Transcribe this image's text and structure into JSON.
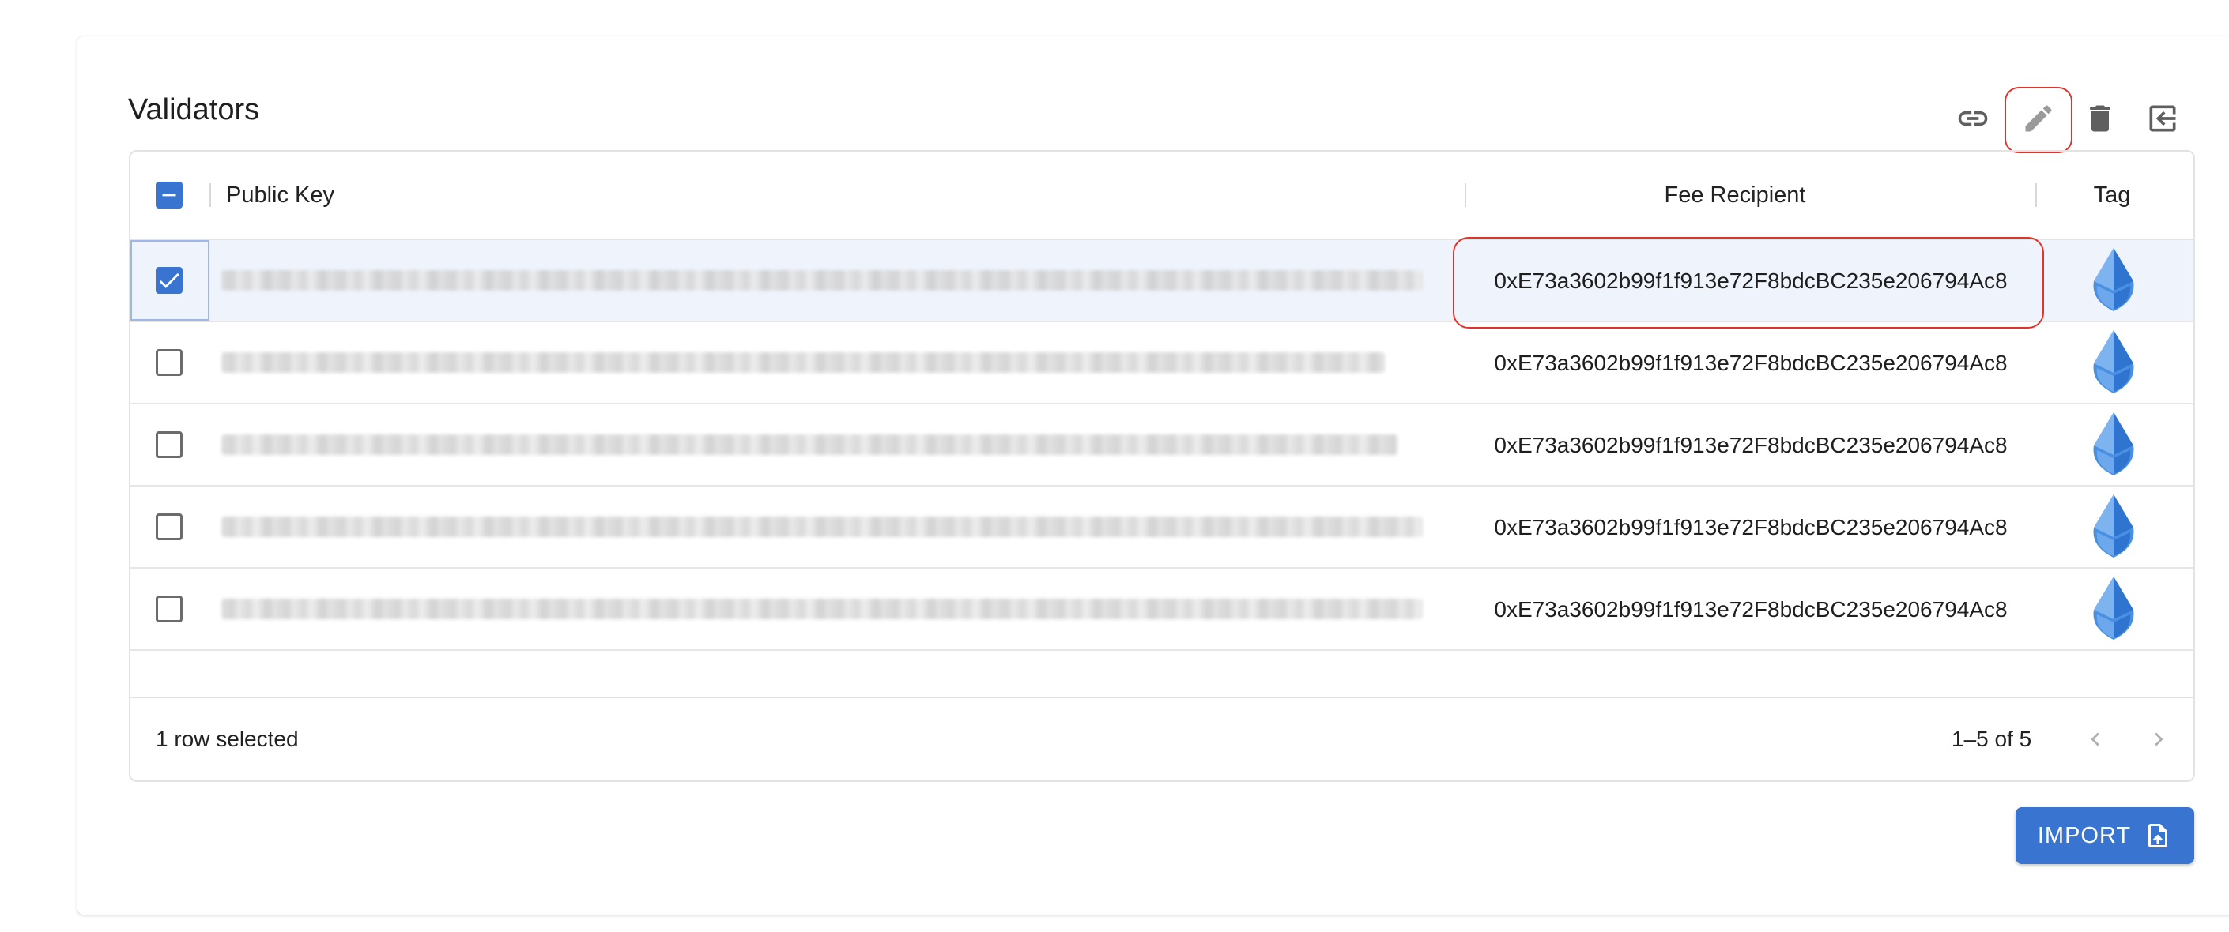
{
  "card": {
    "title": "Validators"
  },
  "toolbar": {
    "icons": [
      "link-icon",
      "edit-icon",
      "delete-icon",
      "exit-icon"
    ]
  },
  "table": {
    "columns": {
      "public_key": "Public Key",
      "fee_recipient": "Fee Recipient",
      "tag": "Tag"
    },
    "rows": [
      {
        "selected": true,
        "fee_recipient": "0xE73a3602b99f1f913e72F8bdcBC235e206794Ac8",
        "tag_icon": "ethereum-drop-icon"
      },
      {
        "selected": false,
        "fee_recipient": "0xE73a3602b99f1f913e72F8bdcBC235e206794Ac8",
        "tag_icon": "ethereum-drop-icon"
      },
      {
        "selected": false,
        "fee_recipient": "0xE73a3602b99f1f913e72F8bdcBC235e206794Ac8",
        "tag_icon": "ethereum-drop-icon"
      },
      {
        "selected": false,
        "fee_recipient": "0xE73a3602b99f1f913e72F8bdcBC235e206794Ac8",
        "tag_icon": "ethereum-drop-icon"
      },
      {
        "selected": false,
        "fee_recipient": "0xE73a3602b99f1f913e72F8bdcBC235e206794Ac8",
        "tag_icon": "ethereum-drop-icon"
      }
    ]
  },
  "footer": {
    "selected_text": "1 row selected",
    "range_text": "1–5 of 5"
  },
  "import_button": {
    "label": "IMPORT"
  },
  "colors": {
    "accent": "#3a74d1",
    "highlight": "#e0342a"
  }
}
